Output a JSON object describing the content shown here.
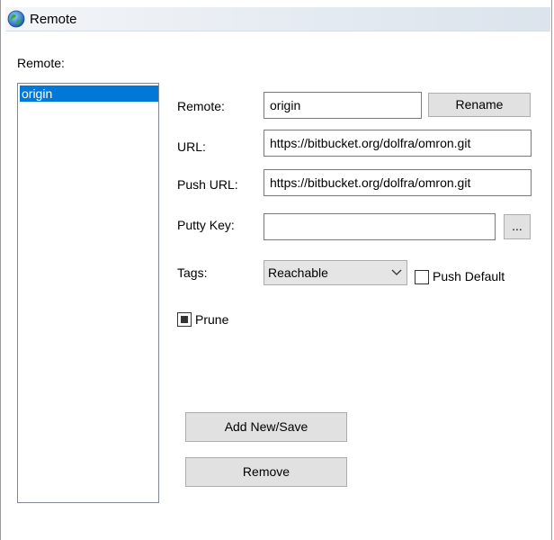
{
  "window": {
    "title": "Remote",
    "icon": "globe-icon"
  },
  "list": {
    "label": "Remote:",
    "items": [
      "origin"
    ]
  },
  "form": {
    "remote_label": "Remote:",
    "remote_value": "origin",
    "rename_label": "Rename",
    "url_label": "URL:",
    "url_value": "https://bitbucket.org/dolfra/omron.git",
    "push_url_label": "Push URL:",
    "push_url_value": "https://bitbucket.org/dolfra/omron.git",
    "putty_key_label": "Putty Key:",
    "putty_key_value": "",
    "browse_label": "...",
    "tags_label": "Tags:",
    "tags_selected": "Reachable",
    "push_default_label": "Push Default",
    "push_default_checked": false,
    "prune_label": "Prune",
    "prune_state": "indeterminate"
  },
  "actions": {
    "add_save_label": "Add New/Save",
    "remove_label": "Remove"
  },
  "colors": {
    "selection": "#0078d7",
    "button_bg": "#e1e1e1"
  }
}
